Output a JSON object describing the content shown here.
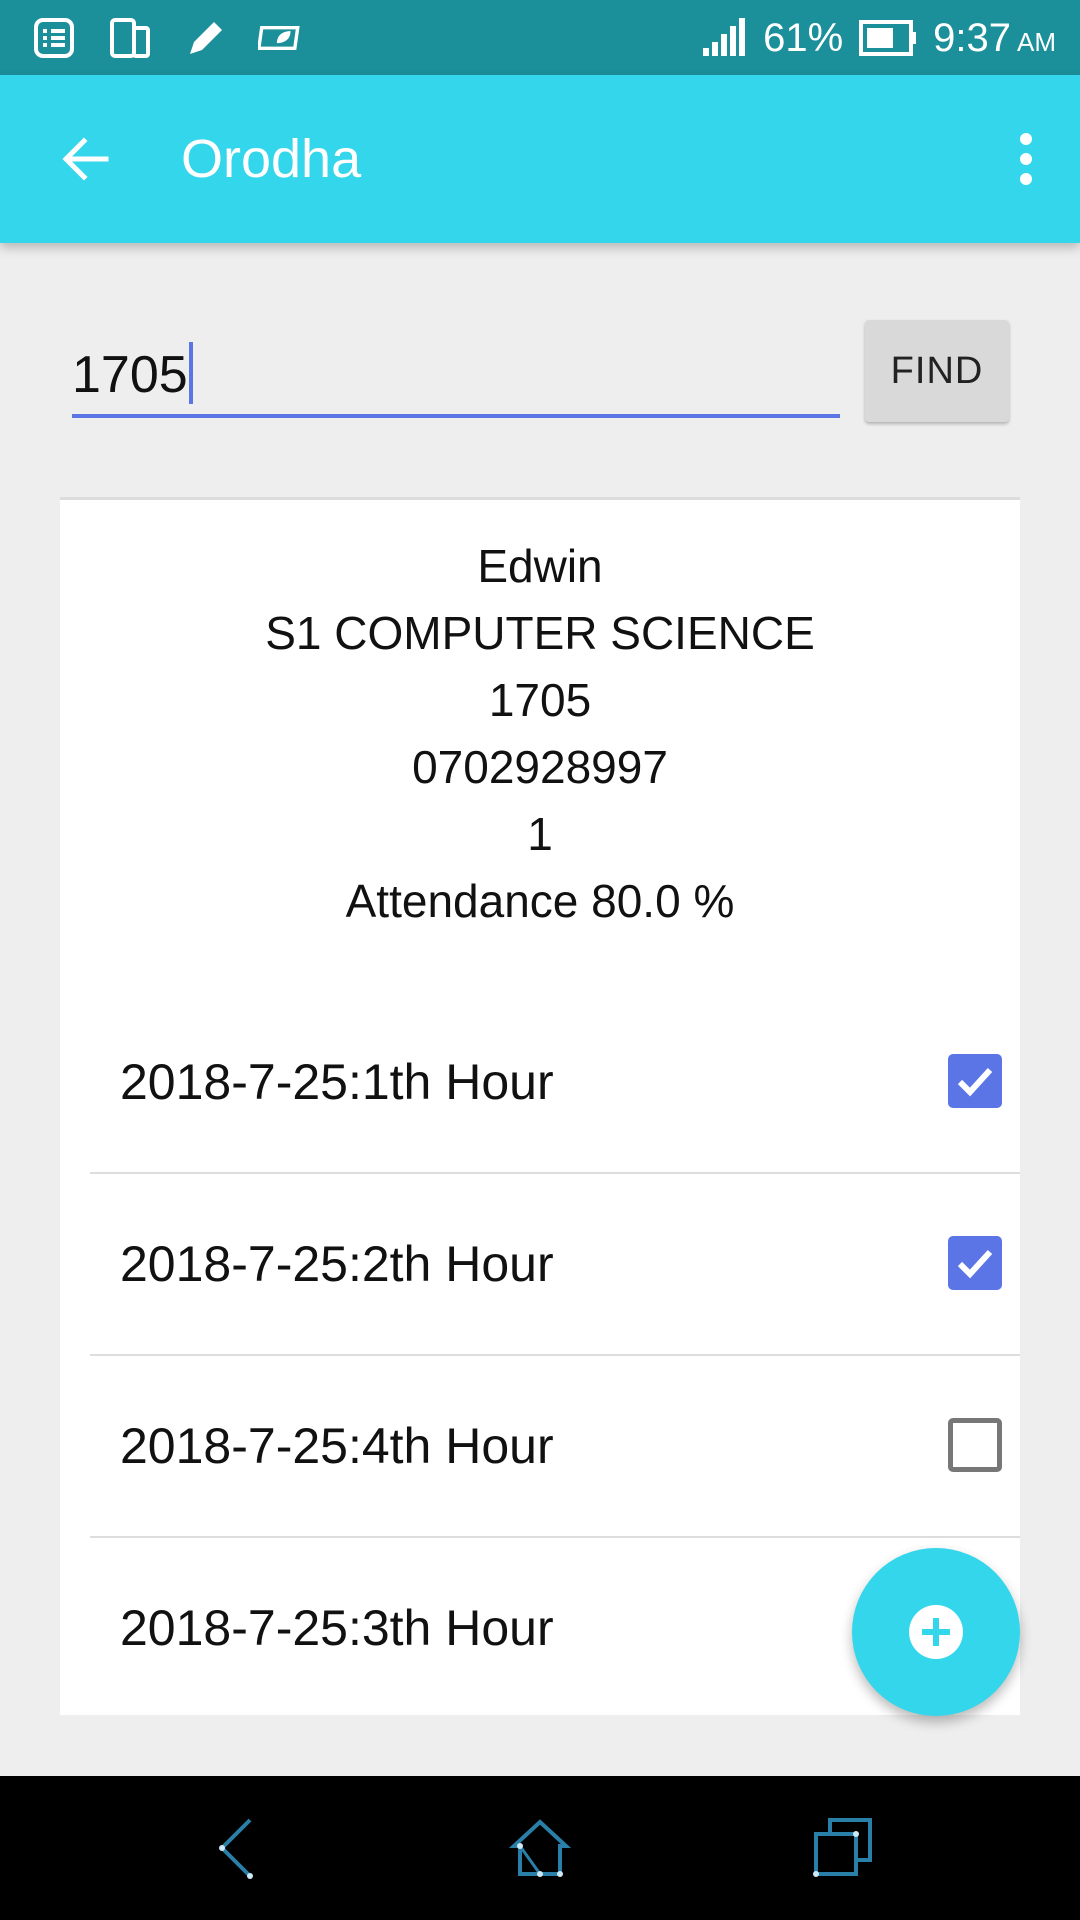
{
  "status_bar": {
    "battery_percent": "61%",
    "time": "9:37",
    "ampm": "AM",
    "icons": [
      "list-notification-icon",
      "phone-clone-icon",
      "pencil-icon",
      "battery-saver-icon",
      "signal-icon",
      "battery-icon"
    ]
  },
  "app_bar": {
    "title": "Orodha",
    "back_icon": "arrow-back-icon",
    "menu_icon": "more-vert-icon"
  },
  "search": {
    "value": "1705",
    "find_label": "FIND"
  },
  "student": {
    "name": "Edwin",
    "class": "S1 COMPUTER SCIENCE",
    "id": "1705",
    "phone": "0702928997",
    "extra": "1",
    "attendance": "Attendance 80.0 %"
  },
  "attendance_rows": [
    {
      "label": "2018-7-25:1th Hour",
      "checked": true
    },
    {
      "label": "2018-7-25:2th Hour",
      "checked": true
    },
    {
      "label": "2018-7-25:4th Hour",
      "checked": false
    },
    {
      "label": "2018-7-25:3th Hour",
      "checked": null
    }
  ],
  "fab": {
    "icon": "add-circle-icon"
  },
  "nav_bar": {
    "icons": [
      "nav-back-icon",
      "nav-home-icon",
      "nav-recents-icon"
    ]
  },
  "colors": {
    "status_bar": "#1b8f9a",
    "app_bar": "#33d6ea",
    "accent": "#5b74e6",
    "background": "#eeeeee"
  }
}
